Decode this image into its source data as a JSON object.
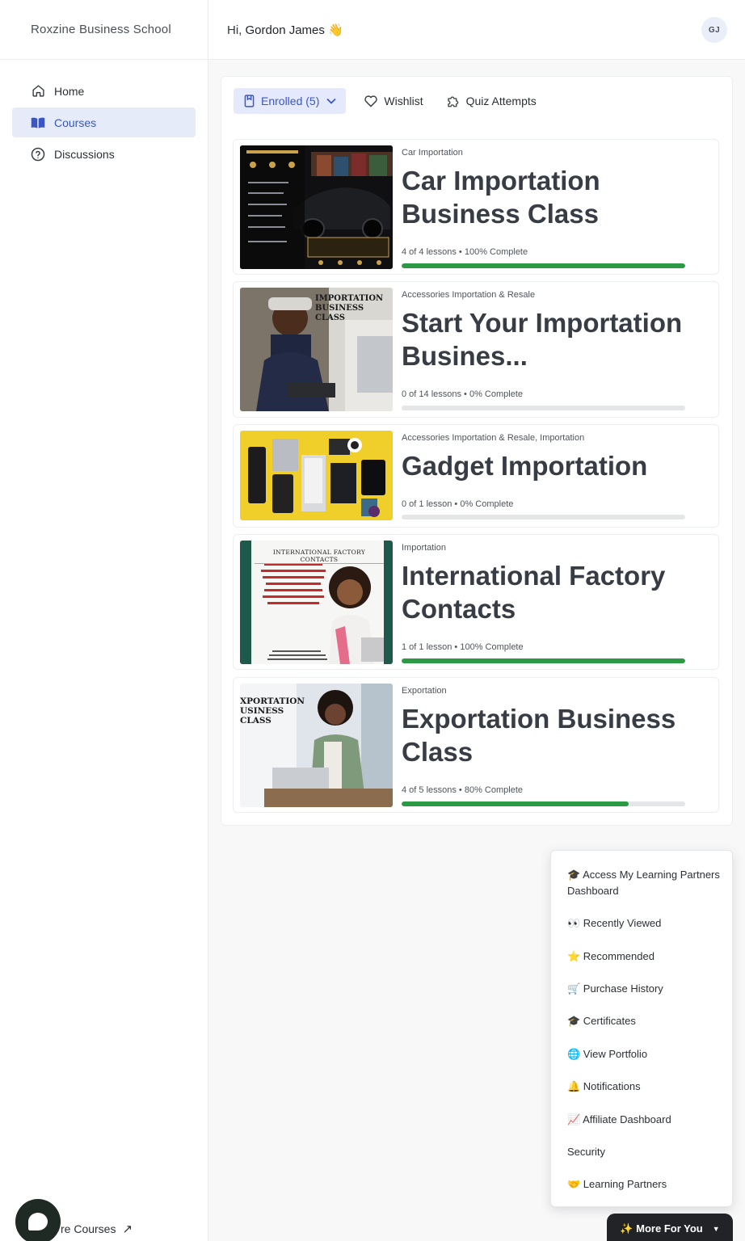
{
  "sidebar": {
    "brand": "Roxzine Business School",
    "items": [
      {
        "label": "Home",
        "icon": "home-icon",
        "active": false
      },
      {
        "label": "Courses",
        "icon": "book-icon",
        "active": true
      },
      {
        "label": "Discussions",
        "icon": "question-circle-icon",
        "active": false
      }
    ],
    "footer_link": "re Courses",
    "footer_icon": "external-arrow-icon"
  },
  "header": {
    "greeting": "Hi,",
    "user_name": "Gordon James",
    "wave": "👋",
    "avatar_initials": "GJ"
  },
  "tabs": [
    {
      "label": "Enrolled (5)",
      "icon": "bookmark-icon",
      "active": true
    },
    {
      "label": "Wishlist",
      "icon": "heart-icon",
      "active": false
    },
    {
      "label": "Quiz Attempts",
      "icon": "puzzle-icon",
      "active": false
    }
  ],
  "courses": [
    {
      "category": "Car Importation",
      "title": "Car Importation Business Class",
      "meta": "4 of 4 lessons • 100% Complete",
      "progress": 1.0
    },
    {
      "category": "Accessories Importation & Resale",
      "title": "Start Your Importation Busines...",
      "meta": "0 of 14 lessons • 0% Complete",
      "progress": 0,
      "thumb_text": "IMPORTATION BUSINESS CLASS"
    },
    {
      "category": "Accessories Importation & Resale, Importation",
      "title": "Gadget Importation",
      "meta": "0 of 1 lesson • 0% Complete",
      "progress": 0
    },
    {
      "category": "Importation",
      "title": "International Factory Contacts",
      "meta": "1 of 1 lesson • 100% Complete",
      "progress": 1.0,
      "thumb_text": "INTERNATIONAL FACTORY CONTACTS"
    },
    {
      "category": "Exportation",
      "title": "Exportation Business Class",
      "meta": "4 of 5 lessons • 80% Complete",
      "progress": 0.8,
      "thumb_text": "XPORTATION USINESS CLASS"
    }
  ],
  "more_menu": {
    "items": [
      "🎓 Access My Learning Partners Dashboard",
      "👀 Recently Viewed",
      "⭐ Recommended",
      "🛒 Purchase History",
      "🎓 Certificates",
      "🌐 View Portfolio",
      "🔔 Notifications",
      "📈 Affiliate Dashboard",
      "Security",
      "🤝 Learning Partners"
    ],
    "button_label": "✨ More For You",
    "caret": "▼"
  },
  "colors": {
    "accent": "#3a56c5",
    "accent_bg": "#e6ebfa",
    "progress": "#2c9a45",
    "progress_track": "#e5e6e8"
  }
}
